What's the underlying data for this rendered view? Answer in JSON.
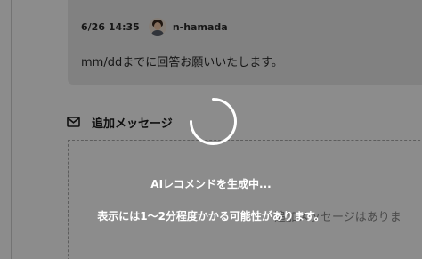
{
  "message": {
    "date": "6/26 14:35",
    "user": "n-hamada",
    "body": "mm/ddまでに回答お願いいたします。"
  },
  "additional_message": {
    "icon": "mail-icon",
    "title": "追加メッセージ",
    "empty_text": "追加メッセージはありま"
  },
  "loading": {
    "icon": "spinner-icon",
    "title": "AIレコメンドを生成中...",
    "note": "表示には1～2分程度かかる可能性があります。"
  },
  "colors": {
    "overlay": "#000000",
    "card_background": "#ececec",
    "text": "#2b2b2b",
    "overlay_text": "#ffffff"
  }
}
